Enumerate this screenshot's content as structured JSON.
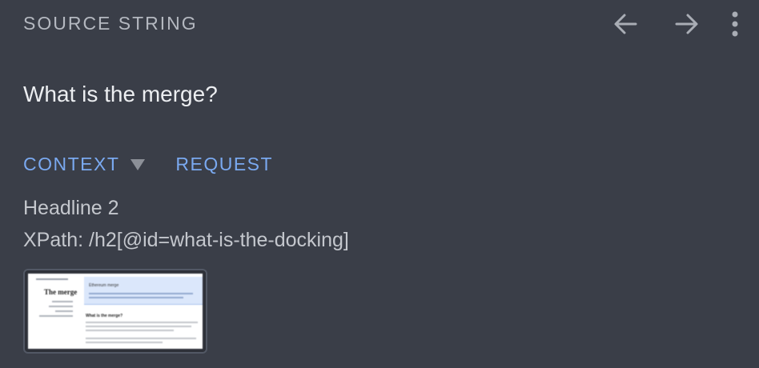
{
  "header": {
    "label": "SOURCE STRING",
    "back_icon": "arrow-left-icon",
    "forward_icon": "arrow-right-icon",
    "more_icon": "more-vert-icon"
  },
  "source": {
    "text": "What is the merge?"
  },
  "tabs": {
    "context_label": "CONTEXT",
    "request_label": "REQUEST"
  },
  "context": {
    "element_type": "Headline 2",
    "xpath": "XPath: /h2[@id=what-is-the-docking]"
  },
  "screenshot_thumbnail": {
    "sidebar_title": "The merge",
    "hero_title": "Ethereum merge",
    "body_heading": "What is the merge?"
  },
  "colors": {
    "background": "#3a3e48",
    "label": "#b4b8c0",
    "accent": "#7aa9f0",
    "primary_text": "#eceef1",
    "secondary_text": "#c4c7cd"
  }
}
